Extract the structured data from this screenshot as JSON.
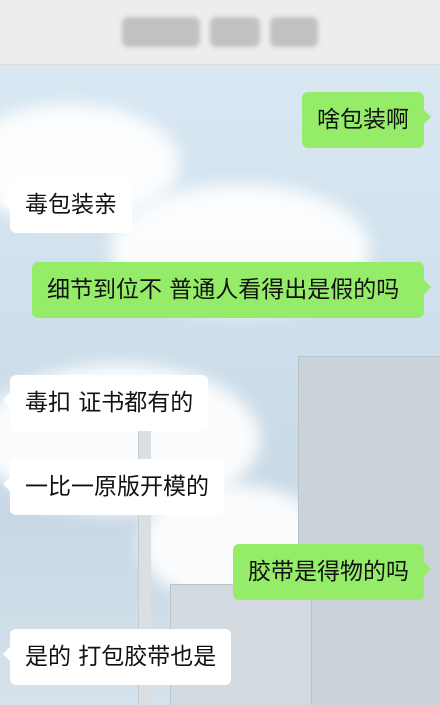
{
  "header": {
    "title_obscured": true,
    "background": "#ededed"
  },
  "messages": [
    {
      "side": "right",
      "text": "啥包装啊"
    },
    {
      "side": "left",
      "text": "毒包装亲"
    },
    {
      "side": "right",
      "text": "细节到位不 普通人看得出是假的吗"
    },
    {
      "side": "left",
      "text": "毒扣 证书都有的"
    },
    {
      "side": "left",
      "text": "一比一原版开模的"
    },
    {
      "side": "right",
      "text": "胶带是得物的吗"
    },
    {
      "side": "left",
      "text": "是的 打包胶带也是"
    }
  ],
  "colors": {
    "bubble_self": "#95ec69",
    "bubble_other": "#ffffff",
    "chat_background": "#cfe0ec"
  }
}
